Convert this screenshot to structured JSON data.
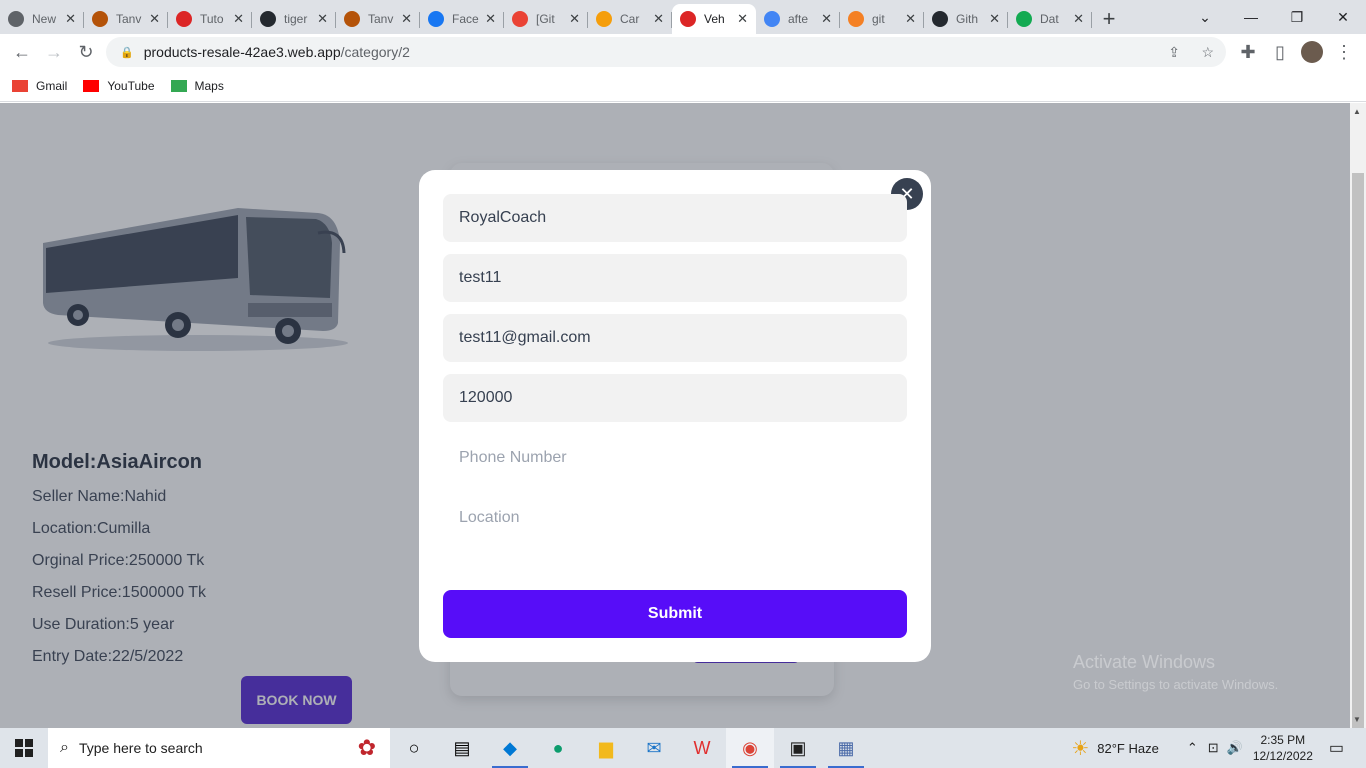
{
  "browser": {
    "tabs": [
      {
        "title": "New",
        "icon": "chrome-icon",
        "color": "#5f6368"
      },
      {
        "title": "Tanv",
        "icon": "person-icon",
        "color": "#b45309"
      },
      {
        "title": "Tuto",
        "icon": "tutorial-icon",
        "color": "#dc2626"
      },
      {
        "title": "tiger",
        "icon": "github-icon",
        "color": "#24292f"
      },
      {
        "title": "Tanv",
        "icon": "person-icon",
        "color": "#b45309"
      },
      {
        "title": "Face",
        "icon": "facebook-icon",
        "color": "#1877f2"
      },
      {
        "title": "[Git",
        "icon": "gmail-icon",
        "color": "#ea4335"
      },
      {
        "title": "Car",
        "icon": "car-icon",
        "color": "#f59e0b"
      },
      {
        "title": "Veh",
        "icon": "vehicle-icon",
        "color": "#dc2626",
        "active": true
      },
      {
        "title": "afte",
        "icon": "google-icon",
        "color": "#4285f4"
      },
      {
        "title": "git",
        "icon": "stackoverflow-icon",
        "color": "#f48024"
      },
      {
        "title": "Gith",
        "icon": "github-icon",
        "color": "#24292f"
      },
      {
        "title": "Dat",
        "icon": "mongodb-icon",
        "color": "#13aa52"
      }
    ],
    "url_domain": "products-resale-42ae3.web.app",
    "url_path": "/category/2",
    "bookmarks": [
      {
        "label": "Gmail",
        "icon": "gmail-icon",
        "color": "#ea4335"
      },
      {
        "label": "YouTube",
        "icon": "youtube-icon",
        "color": "#ff0000"
      },
      {
        "label": "Maps",
        "icon": "maps-icon",
        "color": "#34a853"
      }
    ]
  },
  "product": {
    "model": "Model:AsiaAircon",
    "seller": "Seller Name:Nahid",
    "location": "Location:Cumilla",
    "original_price": "Orginal Price:250000 Tk",
    "resell_price": "Resell Price:1500000 Tk",
    "use_duration": "Use Duration:5 year",
    "entry_date": "Entry Date:22/5/2022",
    "book_label": "BOOK NOW"
  },
  "modal": {
    "close_symbol": "✕",
    "product_name": "RoyalCoach",
    "user_name": "test11",
    "email": "test11@gmail.com",
    "price": "120000",
    "phone_placeholder": "Phone Number",
    "location_placeholder": "Location",
    "submit_label": "Submit"
  },
  "watermark": {
    "title": "Activate Windows",
    "subtitle": "Go to Settings to activate Windows."
  },
  "taskbar": {
    "search_placeholder": "Type here to search",
    "weather": "82°F  Haze",
    "time": "2:35 PM",
    "date": "12/12/2022"
  },
  "colors": {
    "submit": "#570df8",
    "book_now": "#4f1fd1",
    "close_button": "#374151"
  }
}
